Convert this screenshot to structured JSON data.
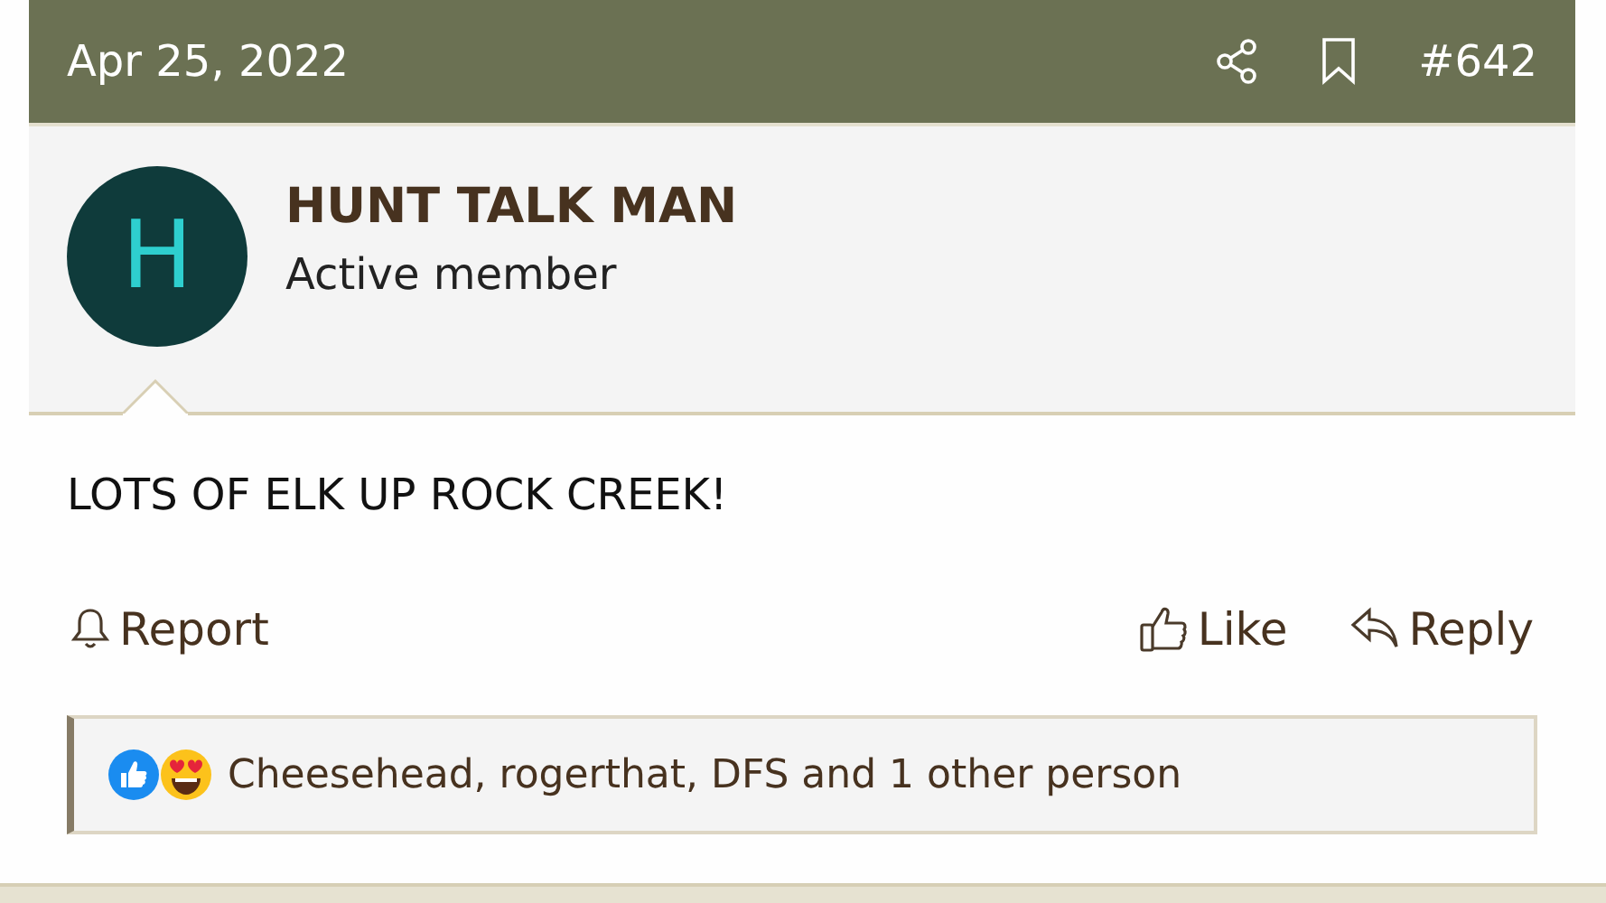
{
  "post": {
    "date": "Apr 25, 2022",
    "number": "#642"
  },
  "author": {
    "avatar_letter": "H",
    "name": "HUNT TALK MAN",
    "title": "Active member"
  },
  "message": "LOTS OF ELK UP ROCK CREEK!",
  "actions": [
    {
      "kind": "report",
      "label": "Report"
    },
    {
      "kind": "like",
      "label": "Like"
    },
    {
      "kind": "reply",
      "label": "Reply"
    }
  ],
  "reactions": {
    "icons": [
      {
        "kind": "like"
      },
      {
        "kind": "love"
      }
    ],
    "text": "Cheesehead, rogerthat, DFS and 1 other person"
  }
}
